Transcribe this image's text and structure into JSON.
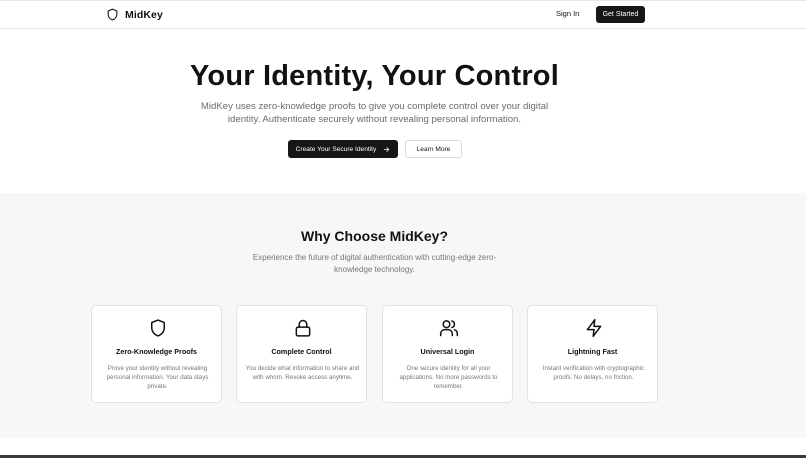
{
  "header": {
    "brand": "MidKey",
    "sign_in": "Sign In",
    "get_started": "Get Started"
  },
  "hero": {
    "title": "Your Identity, Your Control",
    "subtitle": "MidKey uses zero-knowledge proofs to give you complete control over your digital identity. Authenticate securely without revealing personal information.",
    "primary_button": "Create Your Secure Identity",
    "secondary_button": "Learn More"
  },
  "features": {
    "title": "Why Choose MidKey?",
    "subtitle": "Experience the future of digital authentication with cutting-edge zero-knowledge technology.",
    "cards": [
      {
        "icon": "shield-icon",
        "title": "Zero-Knowledge Proofs",
        "description": "Prove your identity without revealing personal information. Your data stays private."
      },
      {
        "icon": "lock-icon",
        "title": "Complete Control",
        "description": "You decide what information to share and with whom. Revoke access anytime."
      },
      {
        "icon": "users-icon",
        "title": "Universal Login",
        "description": "One secure identity for all your applications. No more passwords to remember."
      },
      {
        "icon": "lightning-icon",
        "title": "Lightning Fast",
        "description": "Instant verification with cryptographic proofs. No delays, no friction."
      }
    ]
  },
  "colors": {
    "primary": "#161616",
    "section_bg": "#f7f7f7",
    "muted_text": "#777777"
  }
}
